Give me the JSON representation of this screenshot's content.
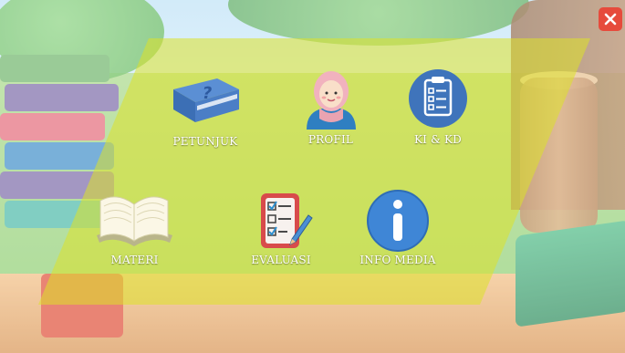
{
  "menu": {
    "petunjuk": {
      "label": "PETUNJUK",
      "icon": "help-book-icon"
    },
    "profil": {
      "label": "PROFIL",
      "icon": "profile-avatar-icon"
    },
    "ki_kd": {
      "label": "KI & KD",
      "icon": "clipboard-checklist-icon"
    },
    "materi": {
      "label": "MATERI",
      "icon": "open-book-icon"
    },
    "evaluasi": {
      "label": "EVALUASI",
      "icon": "checklist-pencil-icon"
    },
    "info_media": {
      "label": "INFO MEDIA",
      "icon": "info-icon"
    }
  },
  "close": {
    "icon": "close-icon"
  },
  "colors": {
    "panel": "#dce228",
    "close_button": "#e64b3c",
    "help_book": "#4b7ec6",
    "info_blue": "#3f86d6",
    "clipboard_circle": "#3f74bb",
    "checklist_red": "#d84b4b"
  }
}
